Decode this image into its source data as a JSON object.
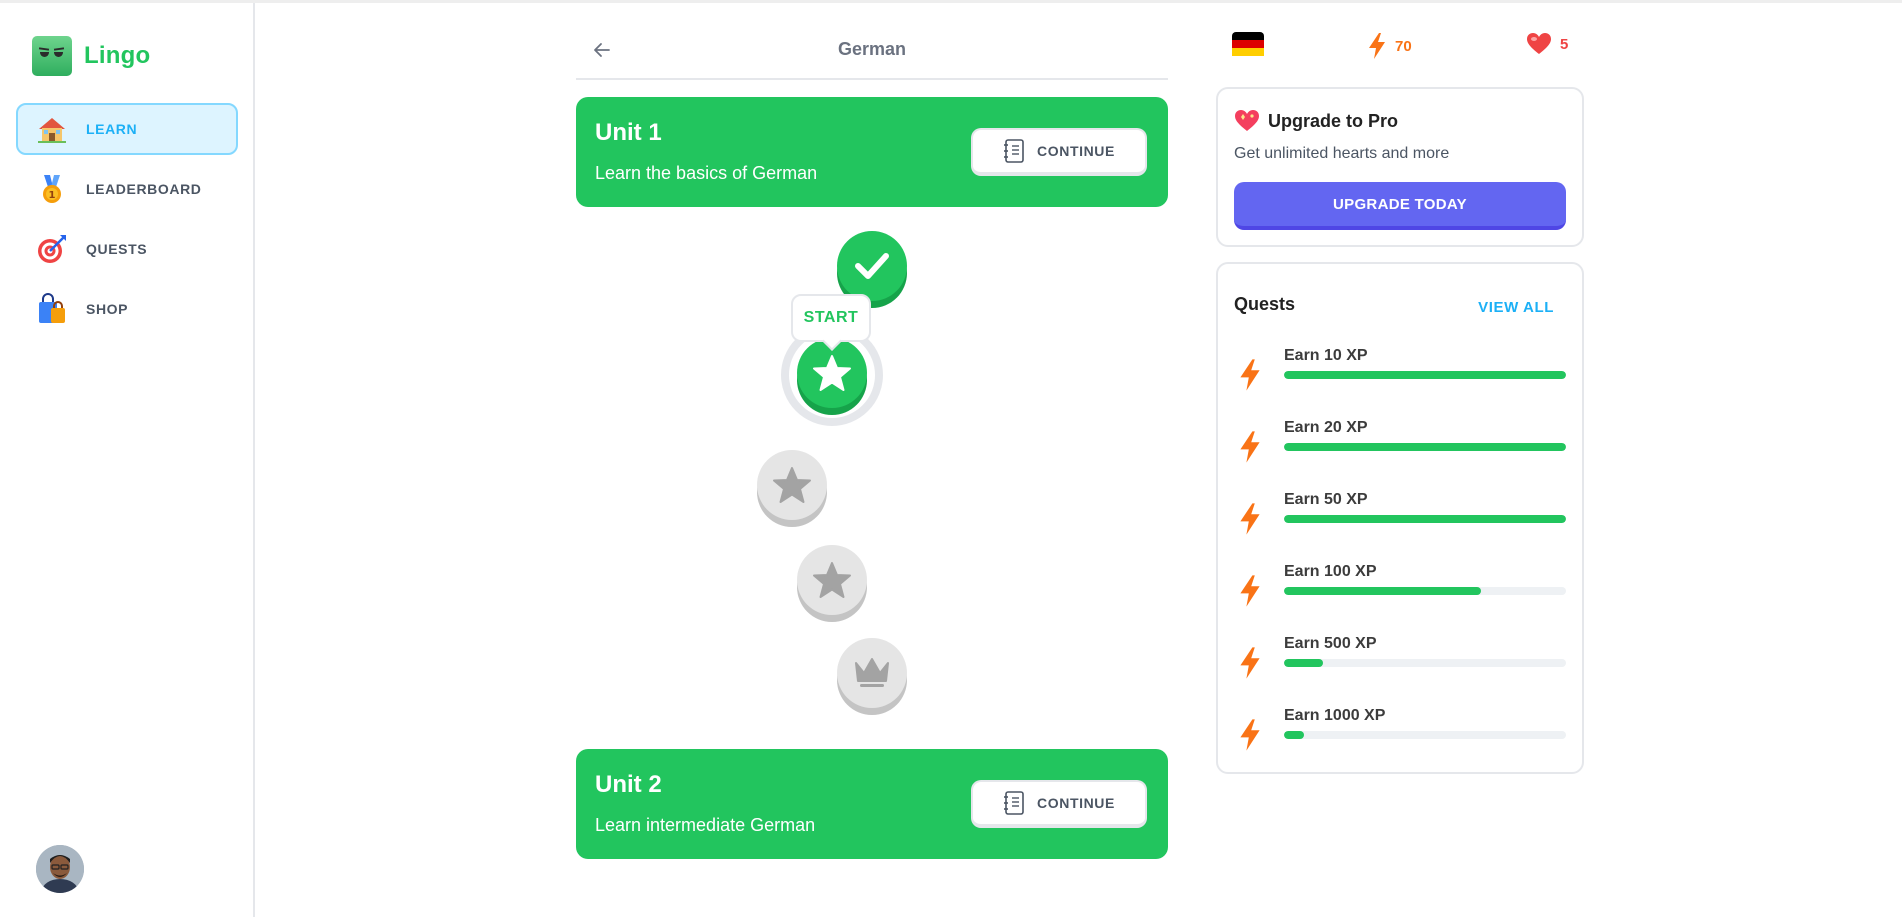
{
  "app": {
    "name": "Lingo",
    "brand_color": "#22c55e"
  },
  "sidebar": {
    "items": [
      {
        "label": "LEARN",
        "icon": "house-icon",
        "active": true
      },
      {
        "label": "LEADERBOARD",
        "icon": "medal-icon",
        "active": false
      },
      {
        "label": "QUESTS",
        "icon": "target-icon",
        "active": false
      },
      {
        "label": "SHOP",
        "icon": "shopping-bag-icon",
        "active": false
      }
    ]
  },
  "header": {
    "title": "German",
    "back_icon": "arrow-left-icon"
  },
  "units": [
    {
      "title": "Unit 1",
      "description": "Learn the basics of German",
      "button_label": "CONTINUE",
      "button_icon": "notebook-icon"
    },
    {
      "title": "Unit 2",
      "description": "Learn intermediate German",
      "button_label": "CONTINUE",
      "button_icon": "notebook-icon"
    }
  ],
  "path": {
    "start_label": "START",
    "lessons": [
      {
        "state": "completed",
        "icon": "check-icon"
      },
      {
        "state": "current",
        "icon": "star-icon"
      },
      {
        "state": "locked",
        "icon": "star-icon"
      },
      {
        "state": "locked",
        "icon": "star-icon"
      },
      {
        "state": "locked",
        "icon": "crown-icon"
      }
    ]
  },
  "stats": {
    "course_flag": "germany-flag-icon",
    "points": "70",
    "points_color": "#f97316",
    "hearts": "5",
    "hearts_color": "#ef4444"
  },
  "promo": {
    "title": "Upgrade to Pro",
    "description": "Get unlimited hearts and more",
    "button_label": "UPGRADE TODAY",
    "button_color": "#6366f1"
  },
  "quests": {
    "title": "Quests",
    "view_all_label": "VIEW ALL",
    "items": [
      {
        "label": "Earn 10 XP",
        "progress": 1.0
      },
      {
        "label": "Earn 20 XP",
        "progress": 1.0
      },
      {
        "label": "Earn 50 XP",
        "progress": 1.0
      },
      {
        "label": "Earn 100 XP",
        "progress": 0.7
      },
      {
        "label": "Earn 500 XP",
        "progress": 0.14
      },
      {
        "label": "Earn 1000 XP",
        "progress": 0.07
      }
    ]
  }
}
